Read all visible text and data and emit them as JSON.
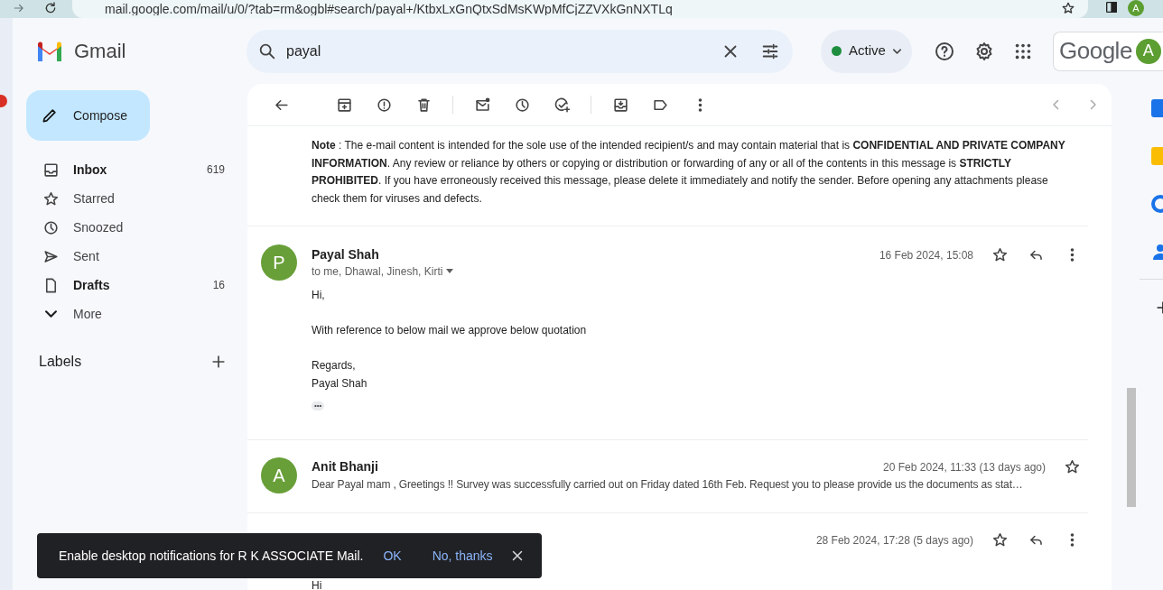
{
  "browser": {
    "url": "mail.google.com/mail/u/0/?tab=rm&ogbl#search/payal+/KtbxLxGnQtxSdMsKWpMfCjZZVXkGnNXTLq",
    "profile_letter": "A"
  },
  "app": {
    "name": "Gmail"
  },
  "search": {
    "value": "payal"
  },
  "status": {
    "label": "Active"
  },
  "account": {
    "brand": "Google",
    "avatar_letter": "A"
  },
  "compose": {
    "label": "Compose"
  },
  "nav": [
    {
      "label": "Inbox",
      "count": "619",
      "bold": true
    },
    {
      "label": "Starred",
      "bold": false
    },
    {
      "label": "Snoozed",
      "bold": false
    },
    {
      "label": "Sent",
      "bold": false
    },
    {
      "label": "Drafts",
      "count": "16",
      "bold": true
    },
    {
      "label": "More",
      "bold": false
    }
  ],
  "labels_heading": "Labels",
  "disclaimer": "**Note** : The e-mail content is intended for the sole use of the intended recipient/s and may contain material that is **CONFIDENTIAL AND PRIVATE COMPANY INFORMATION**. Any review or reliance by others or copying or distribution or forwarding of any or all of the contents in this message is **STRICTLY PROHIBITED**. If you have erroneously received this message, please delete it immediately and notify the sender. Before opening any attachments please check them for viruses and defects.",
  "messages": [
    {
      "kind": "expanded",
      "avatar": "P",
      "sender": "Payal Shah",
      "recipients": "to me, Dhawal, Jinesh, Kirti",
      "date": "16 Feb 2024, 15:08",
      "body": [
        "Hi,",
        "With reference to below mail we approve below quotation",
        "Regards,\nPayal Shah"
      ],
      "show_trimmed": "•••"
    },
    {
      "kind": "collapsed",
      "avatar": "A",
      "sender": "Anit Bhanji",
      "date": "20 Feb 2024, 11:33 (13 days ago)",
      "snippet": "Dear Payal mam , Greetings !! Survey was successfully carried out on Friday dated 16th Feb. Request you to please provide us the documents as stat…"
    },
    {
      "kind": "partial",
      "date": "28 Feb 2024, 17:28 (5 days ago)",
      "body": [
        "Hi"
      ]
    }
  ],
  "snackbar": {
    "message": "Enable desktop notifications for R K ASSOCIATE Mail.",
    "actions": [
      "OK",
      "No, thanks"
    ]
  }
}
